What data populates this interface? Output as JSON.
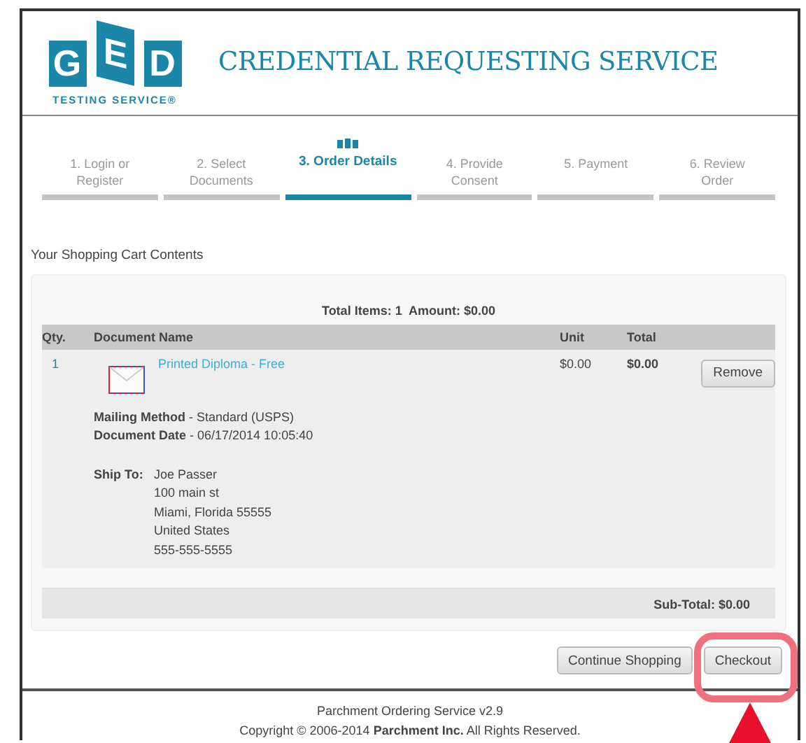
{
  "header": {
    "logo_letters": [
      "G",
      "E",
      "D"
    ],
    "logo_caption": "TESTING SERVICE®",
    "title": "CREDENTIAL REQUESTING SERVICE"
  },
  "steps": [
    {
      "label": "1. Login or Register",
      "selected": false
    },
    {
      "label": "2. Select Documents",
      "selected": false
    },
    {
      "label": "3. Order Details",
      "selected": true
    },
    {
      "label": "4. Provide Consent",
      "selected": false
    },
    {
      "label": "5. Payment",
      "selected": false
    },
    {
      "label": "6. Review Order",
      "selected": false
    }
  ],
  "cart": {
    "heading": "Your Shopping Cart Contents",
    "summary": "Total Items: 1  Amount: $0.00",
    "columns": [
      "Qty.",
      "Document Name",
      "Unit",
      "Total"
    ],
    "items": [
      {
        "qty": "1",
        "name": "Printed Diploma - Free",
        "unit": "$0.00",
        "total": "$0.00",
        "remove": "Remove",
        "details": [
          "**Mailing Method** - Standard (USPS)",
          "**Document Date** - 06/17/2014 10:05:40"
        ],
        "ship_to_label": "Ship To:",
        "ship_to": [
          "Joe Passer",
          "100 main st",
          "Miami, Florida 55555",
          "United States",
          "555-555-5555"
        ]
      }
    ],
    "subtotal": "Sub-Total: $0.00"
  },
  "actions": [
    "Continue Shopping",
    "Checkout"
  ],
  "footer": {
    "version": "Parchment Ordering Service v2.9",
    "copyright": "Copyright © 2006-2014 **Parchment Inc.** All Rights Reserved."
  }
}
